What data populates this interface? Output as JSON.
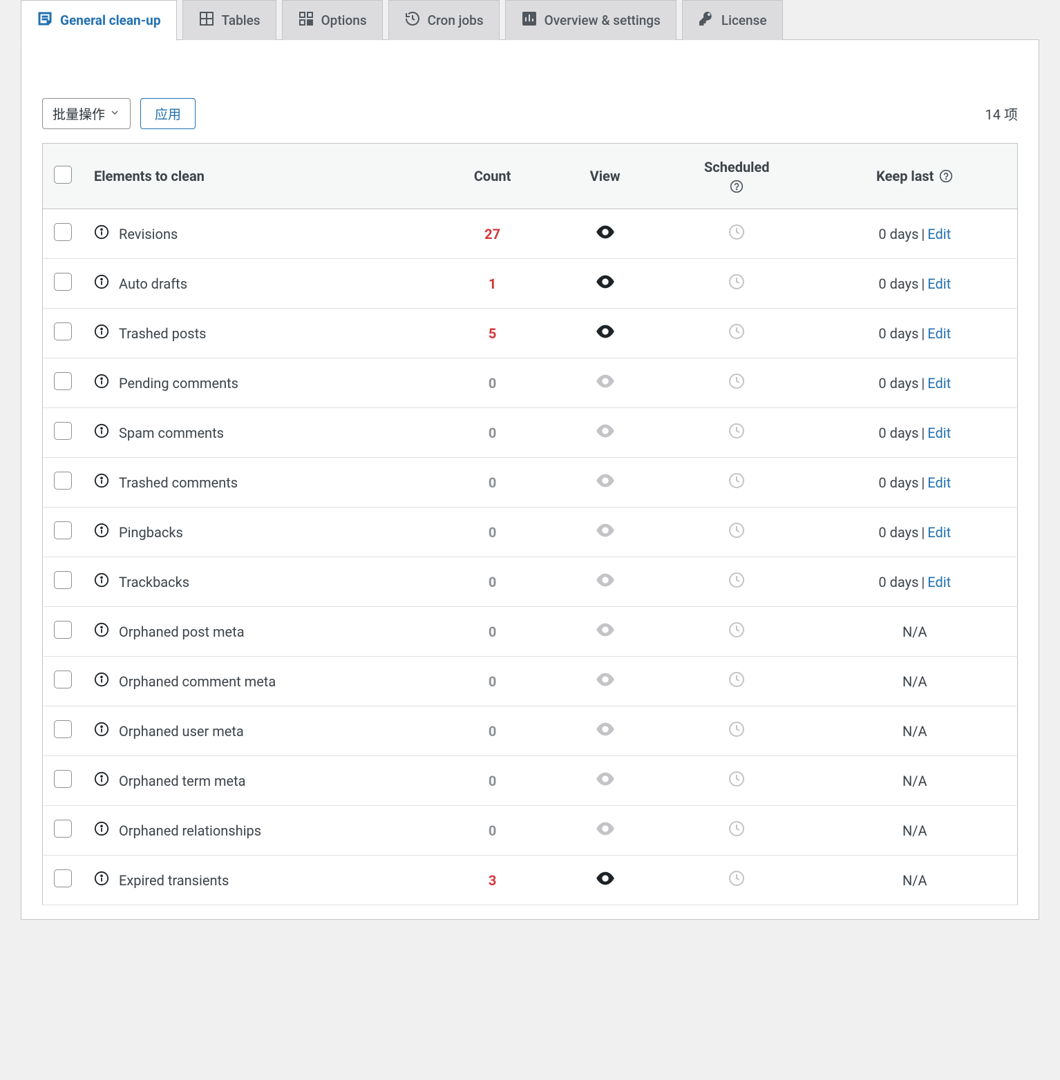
{
  "tabs": [
    {
      "label": "General clean-up",
      "icon": "notes-icon",
      "active": true
    },
    {
      "label": "Tables",
      "icon": "table-icon",
      "active": false
    },
    {
      "label": "Options",
      "icon": "options-icon",
      "active": false
    },
    {
      "label": "Cron jobs",
      "icon": "cron-icon",
      "active": false
    },
    {
      "label": "Overview & settings",
      "icon": "overview-icon",
      "active": false
    },
    {
      "label": "License",
      "icon": "key-icon",
      "active": false
    }
  ],
  "bulk": {
    "select_label": "批量操作",
    "apply_label": "应用"
  },
  "items_count_label": "14 项",
  "headers": {
    "elements": "Elements to clean",
    "count": "Count",
    "view": "View",
    "scheduled": "Scheduled",
    "keep_last": "Keep last"
  },
  "keep_days_label": "0 days",
  "edit_label": "Edit",
  "na_label": "N/A",
  "rows": [
    {
      "name": "Revisions",
      "count": 27,
      "has_keep": true
    },
    {
      "name": "Auto drafts",
      "count": 1,
      "has_keep": true
    },
    {
      "name": "Trashed posts",
      "count": 5,
      "has_keep": true
    },
    {
      "name": "Pending comments",
      "count": 0,
      "has_keep": true
    },
    {
      "name": "Spam comments",
      "count": 0,
      "has_keep": true
    },
    {
      "name": "Trashed comments",
      "count": 0,
      "has_keep": true
    },
    {
      "name": "Pingbacks",
      "count": 0,
      "has_keep": true
    },
    {
      "name": "Trackbacks",
      "count": 0,
      "has_keep": true
    },
    {
      "name": "Orphaned post meta",
      "count": 0,
      "has_keep": false
    },
    {
      "name": "Orphaned comment meta",
      "count": 0,
      "has_keep": false
    },
    {
      "name": "Orphaned user meta",
      "count": 0,
      "has_keep": false
    },
    {
      "name": "Orphaned term meta",
      "count": 0,
      "has_keep": false
    },
    {
      "name": "Orphaned relationships",
      "count": 0,
      "has_keep": false
    },
    {
      "name": "Expired transients",
      "count": 3,
      "has_keep": false
    }
  ]
}
